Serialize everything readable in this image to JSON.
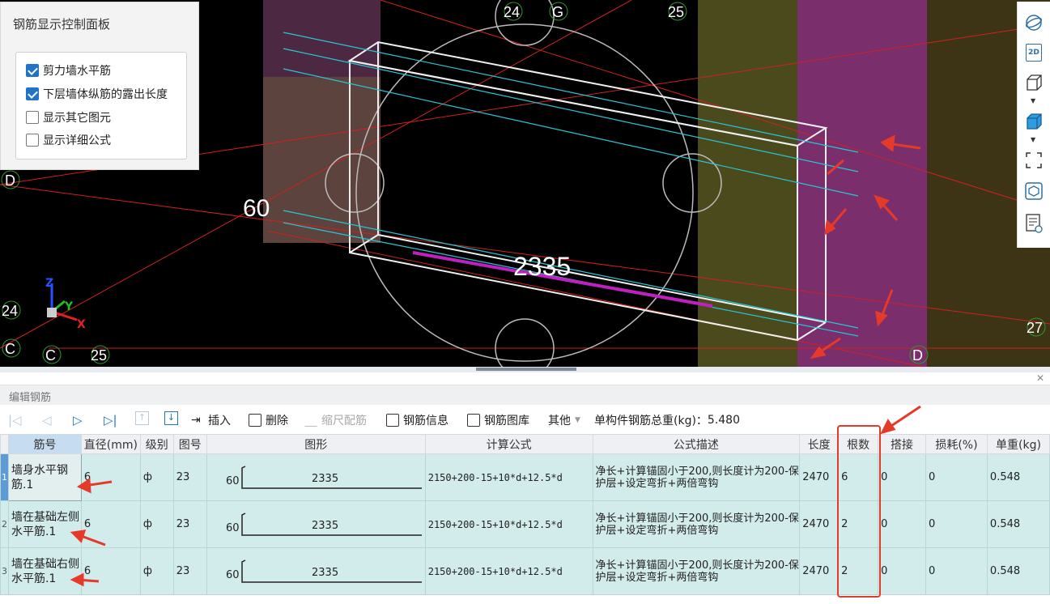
{
  "control_panel": {
    "title": "钢筋显示控制面板",
    "options": [
      {
        "label": "剪力墙水平筋",
        "checked": true
      },
      {
        "label": "下层墙体纵筋的露出长度",
        "checked": true
      },
      {
        "label": "显示其它图元",
        "checked": false
      },
      {
        "label": "显示详细公式",
        "checked": false
      }
    ]
  },
  "viewport": {
    "dimension_left": "60",
    "dimension_length": "2335",
    "axis_markers": [
      "24",
      "G",
      "25",
      "D",
      "24",
      "C",
      "C",
      "25",
      "27",
      "D"
    ],
    "axes": {
      "z": "Z",
      "y": "Y",
      "x": "X"
    }
  },
  "side_toolbar": {
    "icons": [
      "sphere-view-icon",
      "2d-view-icon",
      "wireframe-cube-icon",
      "solid-cube-icon",
      "fit-view-icon",
      "component-view-icon",
      "report-view-icon"
    ],
    "label_2d": "2D"
  },
  "editor": {
    "title": "编辑钢筋",
    "toolbar": {
      "insert": "插入",
      "delete": "删除",
      "scale": "缩尺配筋",
      "info": "钢筋信息",
      "library": "钢筋图库",
      "other": "其他",
      "total_weight_label": "单构件钢筋总重(kg)：",
      "total_weight": "5.480"
    },
    "columns": [
      "筋号",
      "直径(mm)",
      "级别",
      "图号",
      "图形",
      "计算公式",
      "公式描述",
      "长度",
      "根数",
      "搭接",
      "损耗(%)",
      "单重(kg)"
    ],
    "rows": [
      {
        "index": "1",
        "code": "墙身水平钢筋.1",
        "diameter": "6",
        "grade": "ф",
        "figure": "23",
        "shape_left": "60",
        "shape_length": "2335",
        "formula": "2150+200-15+10*d+12.5*d",
        "desc": "净长+计算锚固小于200,则长度计为200-保护层+设定弯折+两倍弯钩",
        "length": "2470",
        "count": "6",
        "lap": "0",
        "loss": "0",
        "unit_weight": "0.548"
      },
      {
        "index": "2",
        "code": "墙在基础左侧水平筋.1",
        "diameter": "6",
        "grade": "ф",
        "figure": "23",
        "shape_left": "60",
        "shape_length": "2335",
        "formula": "2150+200-15+10*d+12.5*d",
        "desc": "净长+计算锚固小于200,则长度计为200-保护层+设定弯折+两倍弯钩",
        "length": "2470",
        "count": "2",
        "lap": "0",
        "loss": "0",
        "unit_weight": "0.548"
      },
      {
        "index": "3",
        "code": "墙在基础右侧水平筋.1",
        "diameter": "6",
        "grade": "ф",
        "figure": "23",
        "shape_left": "60",
        "shape_length": "2335",
        "formula": "2150+200-15+10*d+12.5*d",
        "desc": "净长+计算锚固小于200,则长度计为200-保护层+设定弯折+两倍弯钩",
        "length": "2470",
        "count": "2",
        "lap": "0",
        "loss": "0",
        "unit_weight": "0.548"
      }
    ]
  }
}
